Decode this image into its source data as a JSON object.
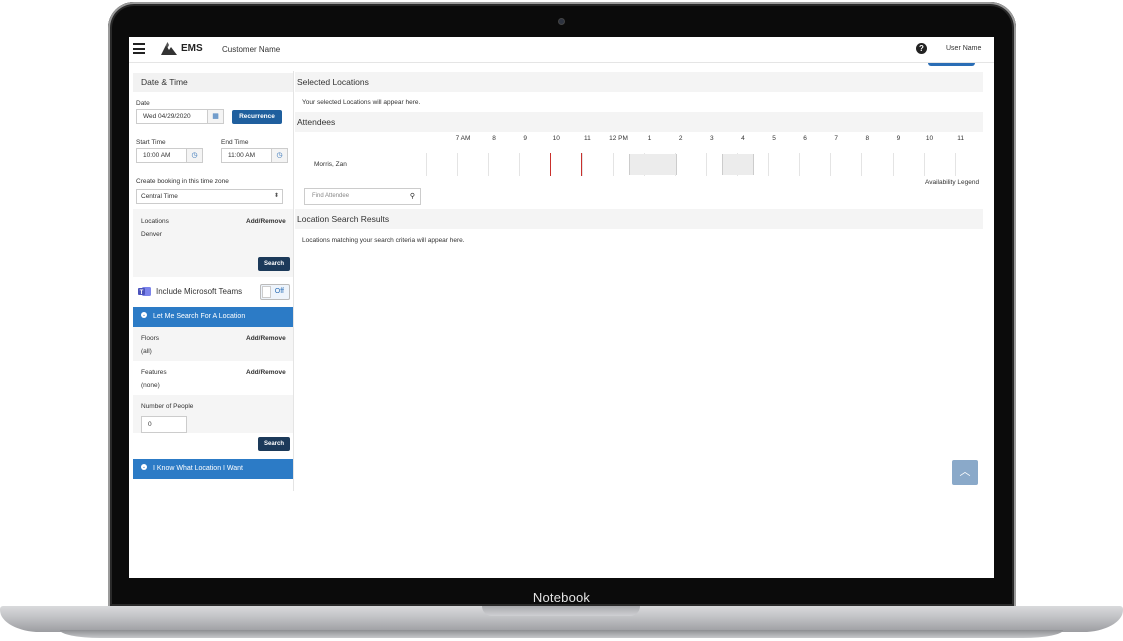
{
  "device": {
    "brand": "Notebook"
  },
  "header": {
    "logo_text": "EMS",
    "customer_label": "Customer Name",
    "help_icon": "question-circle-icon",
    "user_label": "User Name"
  },
  "sidebar": {
    "date_time_header": "Date & Time",
    "date_label": "Date",
    "date_value": "Wed 04/29/2020",
    "recurrence_label": "Recurrence",
    "start_time_label": "Start Time",
    "start_time_value": "10:00 AM",
    "end_time_label": "End Time",
    "end_time_value": "11:00 AM",
    "timezone_label": "Create booking in this time zone",
    "timezone_value": "Central Time",
    "locations_label": "Locations",
    "add_remove_label": "Add/Remove",
    "locations_value": "Denver",
    "search_label": "Search",
    "teams_label": "Include Microsoft Teams",
    "teams_toggle": "Off",
    "let_me_search_label": "Let Me Search For A Location",
    "floors_label": "Floors",
    "floors_value": "(all)",
    "features_label": "Features",
    "features_value": "(none)",
    "people_label": "Number of People",
    "people_value": "0",
    "know_location_label": "I Know What Location I Want"
  },
  "main": {
    "selected_header": "Selected Locations",
    "selected_text": "Your selected Locations will appear here.",
    "attendees_header": "Attendees",
    "hours": [
      "7 AM",
      "8",
      "9",
      "10",
      "11",
      "12 PM",
      "1",
      "2",
      "3",
      "4",
      "5",
      "6",
      "7",
      "8",
      "9",
      "10",
      "11"
    ],
    "attendee_name": "Morris, Zan",
    "availability_legend": "Availability Legend",
    "find_attendee_placeholder": "Find Attendee",
    "results_header": "Location Search Results",
    "results_text": "Locations matching your search criteria will appear here."
  },
  "colors": {
    "accent": "#2c7bc6",
    "button_dark": "#1c3a5a",
    "current_time_line": "#c9302c"
  }
}
